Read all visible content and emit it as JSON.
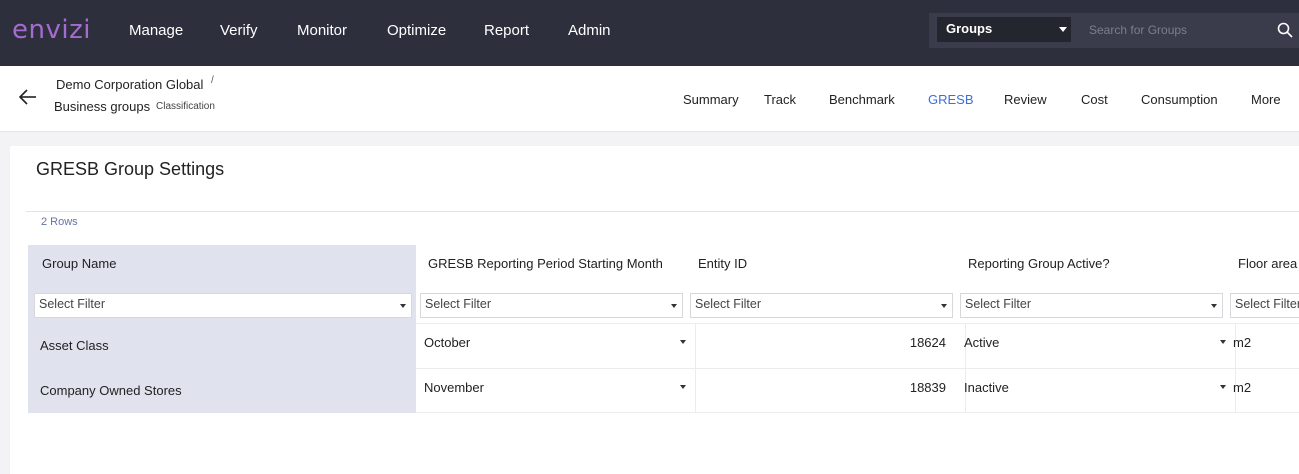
{
  "brand": {
    "logo_text": "envizi",
    "logo_color": "#a66bd1"
  },
  "nav": {
    "items": [
      "Manage",
      "Verify",
      "Monitor",
      "Optimize",
      "Report",
      "Admin"
    ]
  },
  "group_selector": {
    "value": "Groups"
  },
  "search": {
    "placeholder": "Search for Groups"
  },
  "breadcrumb": {
    "root": "Demo Corporation Global",
    "separator": "/",
    "current": "Business groups",
    "tag": "Classification"
  },
  "tabs": [
    {
      "label": "Summary",
      "active": false
    },
    {
      "label": "Track",
      "active": false
    },
    {
      "label": "Benchmark",
      "active": false
    },
    {
      "label": "GRESB",
      "active": true
    },
    {
      "label": "Review",
      "active": false
    },
    {
      "label": "Cost",
      "active": false
    },
    {
      "label": "Consumption",
      "active": false
    },
    {
      "label": "More",
      "active": false
    }
  ],
  "panel": {
    "title": "GRESB Group Settings",
    "row_count_label": "2 Rows"
  },
  "table": {
    "columns": [
      "Group Name",
      "GRESB Reporting Period Starting Month",
      "Entity ID",
      "Reporting Group Active?",
      "Floor area"
    ],
    "filter_placeholder": "Select Filter",
    "rows": [
      {
        "group_name": "Asset Class",
        "month": "October",
        "entity_id": "18624",
        "active": "Active",
        "floor_unit": "m2"
      },
      {
        "group_name": "Company Owned Stores",
        "month": "November",
        "entity_id": "18839",
        "active": "Inactive",
        "floor_unit": "m2"
      }
    ]
  },
  "colors": {
    "topbar": "#2d2f3d",
    "active_tab": "#3e6fd8",
    "pinned_column": "#e0e2ee"
  }
}
